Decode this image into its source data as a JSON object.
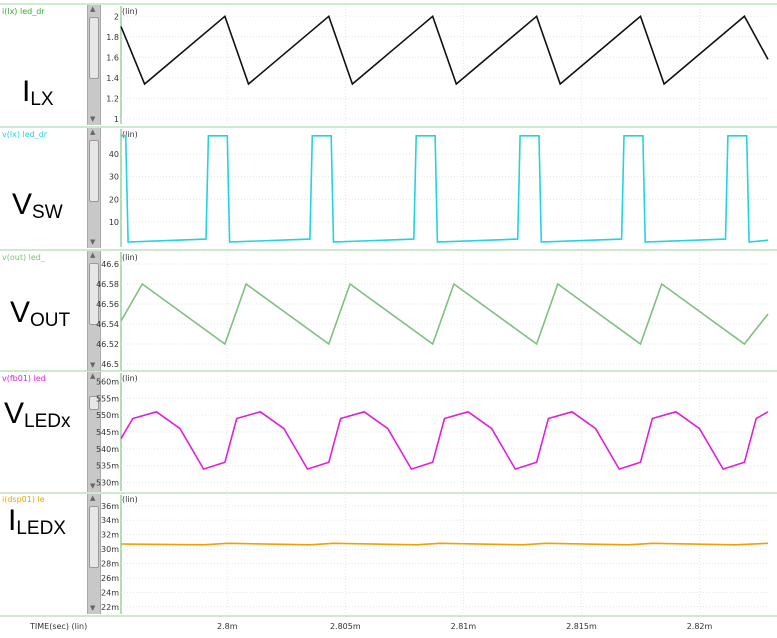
{
  "window": {
    "x_axis_label": "TIME(sec) (lin)"
  },
  "chart_data": [
    {
      "type": "line",
      "trace_label": "i(lx) led_dr",
      "scale_label": "(lin)",
      "side_label": {
        "main": "I",
        "sub": "LX"
      },
      "color": "#111111",
      "yticks": [
        "2",
        "1.8",
        "1.6",
        "1.4",
        "1.2",
        "1"
      ],
      "ytick_values": [
        2,
        1.8,
        1.6,
        1.4,
        1.2,
        1
      ],
      "ylim": [
        0.95,
        2.1
      ],
      "series": [
        {
          "x": [
            2.7955,
            2.7965,
            2.7999,
            2.8009,
            2.8043,
            2.8053,
            2.8087,
            2.8097,
            2.8131,
            2.8141,
            2.8175,
            2.8185,
            2.8219,
            2.8229
          ],
          "y": [
            1.9,
            1.34,
            2.0,
            1.34,
            2.0,
            1.34,
            2.0,
            1.34,
            2.0,
            1.34,
            2.0,
            1.34,
            2.0,
            1.58
          ]
        }
      ]
    },
    {
      "type": "line",
      "trace_label": "v(lx) led_dr",
      "scale_label": "(lin)",
      "side_label": {
        "main": "V",
        "sub": "SW"
      },
      "color": "#22d3e0",
      "yticks": [
        "40",
        "30",
        "20",
        "10"
      ],
      "ytick_values": [
        40,
        30,
        20,
        10
      ],
      "ylim": [
        -1,
        51
      ],
      "series": [
        {
          "x": [
            2.7955,
            2.7957,
            2.7958,
            2.7991,
            2.7992,
            2.8,
            2.8001,
            2.8035,
            2.8036,
            2.8044,
            2.8045,
            2.8079,
            2.808,
            2.8088,
            2.8089,
            2.8123,
            2.8124,
            2.8132,
            2.8133,
            2.8167,
            2.8168,
            2.8176,
            2.8177,
            2.8211,
            2.8212,
            2.822,
            2.8221,
            2.8229
          ],
          "y": [
            48,
            48,
            1.2,
            2.5,
            48,
            48,
            1.2,
            2.5,
            48,
            48,
            1.2,
            2.5,
            48,
            48,
            1.2,
            2.5,
            48,
            48,
            1.2,
            2.5,
            48,
            48,
            1.2,
            2.5,
            48,
            48,
            1.2,
            2.0
          ]
        }
      ]
    },
    {
      "type": "line",
      "trace_label": "v(out) led_",
      "scale_label": "(lin)",
      "side_label": {
        "main": "V",
        "sub": "OUT"
      },
      "color": "#7fbf7f",
      "yticks": [
        "46.6",
        "46.58",
        "46.56",
        "46.54",
        "46.52",
        "46.5"
      ],
      "ytick_values": [
        46.6,
        46.58,
        46.56,
        46.54,
        46.52,
        46.5
      ],
      "ylim": [
        46.494,
        46.612
      ],
      "series": [
        {
          "x": [
            2.7955,
            2.7964,
            2.7999,
            2.8008,
            2.8043,
            2.8052,
            2.8087,
            2.8096,
            2.8131,
            2.814,
            2.8175,
            2.8184,
            2.8219,
            2.8229
          ],
          "y": [
            46.543,
            46.58,
            46.52,
            46.58,
            46.52,
            46.58,
            46.52,
            46.58,
            46.52,
            46.58,
            46.52,
            46.58,
            46.52,
            46.55
          ]
        }
      ]
    },
    {
      "type": "line",
      "trace_label": "v(fb01) led",
      "scale_label": "(lin)",
      "side_label": {
        "main": "V",
        "sub": "LEDx"
      },
      "color": "#e020d8",
      "yticks": [
        "560m",
        "555m",
        "550m",
        "545m",
        "540m",
        "535m",
        "530m"
      ],
      "ytick_values": [
        0.56,
        0.555,
        0.55,
        0.545,
        0.54,
        0.535,
        0.53
      ],
      "ylim": [
        0.5275,
        0.5625
      ],
      "series": [
        {
          "x": [
            2.7955,
            2.796,
            2.797,
            2.798,
            2.799,
            2.7999,
            2.8004,
            2.8014,
            2.8024,
            2.8034,
            2.8043,
            2.8048,
            2.8058,
            2.8068,
            2.8078,
            2.8087,
            2.8092,
            2.8102,
            2.8112,
            2.8122,
            2.8131,
            2.8136,
            2.8146,
            2.8156,
            2.8166,
            2.8175,
            2.818,
            2.819,
            2.82,
            2.821,
            2.8219,
            2.8224,
            2.8229
          ],
          "y": [
            0.543,
            0.549,
            0.551,
            0.546,
            0.534,
            0.536,
            0.549,
            0.551,
            0.546,
            0.534,
            0.536,
            0.549,
            0.551,
            0.546,
            0.534,
            0.536,
            0.549,
            0.551,
            0.546,
            0.534,
            0.536,
            0.549,
            0.551,
            0.546,
            0.534,
            0.536,
            0.549,
            0.551,
            0.546,
            0.534,
            0.536,
            0.549,
            0.551
          ]
        }
      ]
    },
    {
      "type": "line",
      "trace_label": "i(dsp01) le",
      "scale_label": "(lin)",
      "side_label": {
        "main": "I",
        "sub": "LEDX"
      },
      "color": "#f0a000",
      "yticks": [
        "36m",
        "34m",
        "32m",
        "30m",
        "28m",
        "26m",
        "24m",
        "22m"
      ],
      "ytick_values": [
        0.036,
        0.034,
        0.032,
        0.03,
        0.028,
        0.026,
        0.024,
        0.022
      ],
      "ylim": [
        0.021,
        0.0375
      ],
      "series": [
        {
          "x": [
            2.7955,
            2.799,
            2.8,
            2.8035,
            2.8045,
            2.808,
            2.809,
            2.8125,
            2.8135,
            2.817,
            2.818,
            2.8215,
            2.8229
          ],
          "y": [
            0.0307,
            0.0306,
            0.0308,
            0.0306,
            0.0308,
            0.0306,
            0.0308,
            0.0306,
            0.0308,
            0.0306,
            0.0308,
            0.0306,
            0.0308
          ]
        }
      ]
    }
  ],
  "x_axis": {
    "label": "TIME(sec) (lin)",
    "xlim": [
      2.7955,
      2.8229
    ],
    "ticks": [
      "2.8m",
      "2.805m",
      "2.81m",
      "2.815m",
      "2.82m"
    ],
    "tick_values": [
      2.8,
      2.805,
      2.81,
      2.815,
      2.82
    ]
  }
}
